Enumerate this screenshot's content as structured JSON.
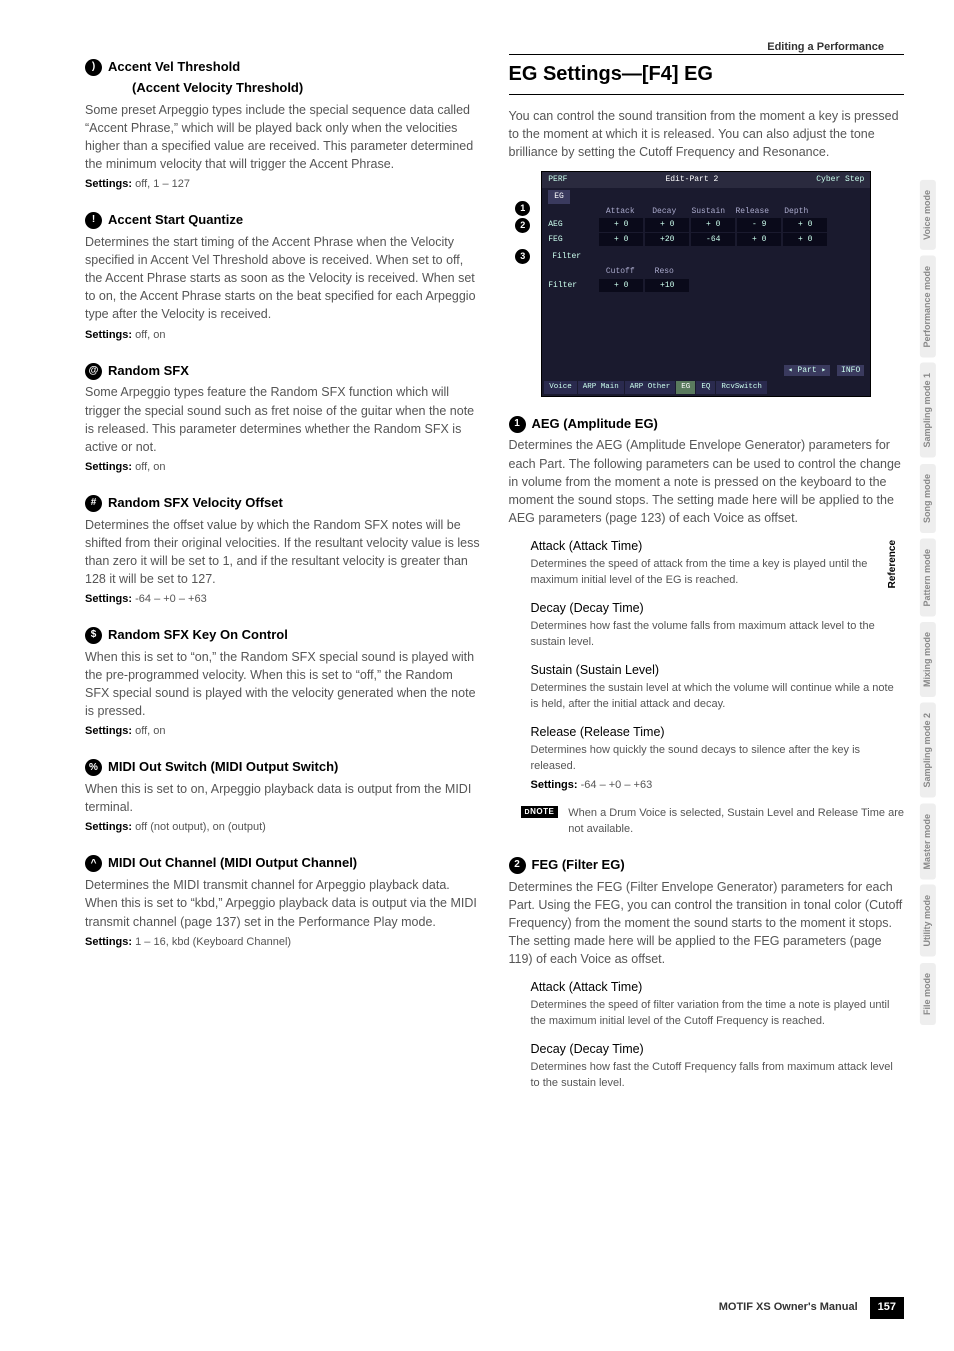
{
  "header": {
    "breadcrumb": "Editing a Performance"
  },
  "left": {
    "item10": {
      "num": "⓾",
      "title": "Accent Vel Threshold",
      "subtitle": "(Accent Velocity Threshold)",
      "body": "Some preset Arpeggio types include the special sequence data called “Accent Phrase,” which will be played back only when the velocities higher than a specified value are received. This parameter determined the minimum velocity that will trigger the Accent Phrase.",
      "settings": "off, 1 – 127"
    },
    "item11": {
      "num": "⓫",
      "title": "Accent Start Quantize",
      "body": "Determines the start timing of the Accent Phrase when the Velocity specified in Accent Vel Threshold above is received. When set to off, the Accent Phrase starts as soon as the Velocity is received. When set to on, the Accent Phrase starts on the beat specified for each Arpeggio type after the Velocity is received.",
      "settings": "off, on"
    },
    "item12": {
      "num": "⓬",
      "title": "Random SFX",
      "body": "Some Arpeggio types feature the Random SFX function which will trigger the special sound such as fret noise of the guitar when the note is released. This parameter determines whether the Random SFX is active or not.",
      "settings": "off, on"
    },
    "item13": {
      "num": "⓭",
      "title": "Random SFX Velocity Offset",
      "body": "Determines the offset value by which the Random SFX notes will be shifted from their original velocities. If the resultant velocity value is less than zero it will be set to 1, and if the resultant velocity is greater than 128 it will be set to 127.",
      "settings": "-64 – +0 – +63"
    },
    "item14": {
      "num": "⓮",
      "title": "Random SFX Key On Control",
      "body": "When this is set to “on,” the Random SFX special sound is played with the pre-programmed velocity. When this is set to “off,” the Random SFX special sound is played with the velocity generated when the note is pressed.",
      "settings": "off, on"
    },
    "item15": {
      "num": "⓯",
      "title": "MIDI Out Switch (MIDI Output Switch)",
      "body": "When this is set to on, Arpeggio playback data is output from the MIDI terminal.",
      "settings": "off (not output), on (output)"
    },
    "item16": {
      "num": "⓰",
      "title": "MIDI Out Channel (MIDI Output Channel)",
      "body": "Determines the MIDI transmit channel for Arpeggio playback data. When this is set to “kbd,” Arpeggio playback data is output via the MIDI transmit channel (page 137) set in the Performance Play mode.",
      "settings": "1 – 16, kbd (Keyboard Channel)"
    }
  },
  "right": {
    "major_title": "EG Settings—[F4] EG",
    "intro": "You can control the sound transition from the moment a key is pressed to the moment at which it is released. You can also adjust the tone brilliance by setting the Cutoff Frequency and Resonance.",
    "screenshot": {
      "topLeft": "PERF",
      "topMid": "Edit-Part 2",
      "topRight": "Cyber Step",
      "tab": "EG",
      "headers": [
        "Attack",
        "Decay",
        "Sustain",
        "Release",
        "Depth"
      ],
      "rows": [
        {
          "label": "AEG",
          "cells": [
            "+ 0",
            "+ 0",
            "+ 0",
            "- 9",
            "+ 0"
          ]
        },
        {
          "label": "FEG",
          "cells": [
            "+ 0",
            "+20",
            "-64",
            "+ 0",
            "+ 0"
          ]
        }
      ],
      "filterLabel": "Filter",
      "filterHeaders": [
        "Cutoff",
        "Reso"
      ],
      "filterRow": {
        "label": "Filter",
        "cells": [
          "+ 0",
          "+10"
        ]
      },
      "bottomInfo": [
        "◂ Part ▸",
        "INFO"
      ],
      "bottomTabs": [
        "Voice",
        "ARP Main",
        "ARP Other",
        "EG",
        "EQ",
        "RcvSwitch"
      ],
      "callouts": [
        "1",
        "2",
        "3"
      ]
    },
    "item1": {
      "num": "1",
      "title": "AEG (Amplitude EG)",
      "body": "Determines the AEG (Amplitude Envelope Generator) parameters for each Part. The following parameters can be used to control the change in volume from the moment a note is pressed on the keyboard to the moment the sound stops. The setting made here will be applied to the AEG parameters (page 123) of each Voice as offset.",
      "params": [
        {
          "t": "Attack (Attack Time)",
          "d": "Determines the speed of attack from the time a key is played until the maximum initial level of the EG is reached."
        },
        {
          "t": "Decay (Decay Time)",
          "d": "Determines how fast the volume falls from maximum attack level to the sustain level."
        },
        {
          "t": "Sustain (Sustain Level)",
          "d": "Determines the sustain level at which the volume will continue while a note is held, after the initial attack and decay."
        },
        {
          "t": "Release (Release Time)",
          "d": "Determines how quickly the sound decays to silence after the key is released."
        }
      ],
      "settings": "-64 – +0 – +63",
      "note": "When a Drum Voice is selected, Sustain Level and Release Time are not available."
    },
    "item2": {
      "num": "2",
      "title": "FEG (Filter EG)",
      "body": "Determines the FEG (Filter Envelope Generator) parameters for each Part. Using the FEG, you can control the transition in tonal color (Cutoff Frequency) from the moment the sound starts to the moment it stops. The setting made here will be applied to the FEG parameters (page 119) of each Voice as offset.",
      "params": [
        {
          "t": "Attack (Attack Time)",
          "d": "Determines the speed of filter variation from the time a note is played until the maximum initial level of the Cutoff Frequency is reached."
        },
        {
          "t": "Decay (Decay Time)",
          "d": "Determines how fast the Cutoff Frequency falls from maximum attack level to the sustain level."
        }
      ]
    }
  },
  "sideTabs": [
    "Voice mode",
    "Performance mode",
    "Sampling mode 1",
    "Song mode",
    "Pattern mode",
    "Mixing mode",
    "Sampling mode 2",
    "Master mode",
    "Utility mode",
    "File mode"
  ],
  "sideRef": "Reference",
  "footer": {
    "manual": "MOTIF XS Owner's Manual",
    "page": "157"
  },
  "labels": {
    "settings": "Settings:",
    "note": "NOTE"
  }
}
